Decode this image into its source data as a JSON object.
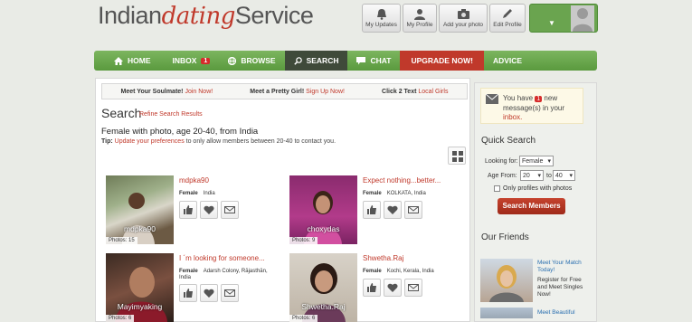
{
  "brand": {
    "logo_left": "Indian",
    "logo_mid": "dating",
    "logo_right": "Service"
  },
  "header_buttons": [
    {
      "label": "My Updates",
      "icon": "bell-icon"
    },
    {
      "label": "My Profile",
      "icon": "person-icon"
    },
    {
      "label": "Add your photo",
      "icon": "camera-icon"
    },
    {
      "label": "Edit Profile",
      "icon": "pencil-icon"
    }
  ],
  "profile_menu": {
    "arrow": "▼"
  },
  "nav": {
    "home": "HOME",
    "inbox": "INBOX",
    "inbox_badge": "1",
    "browse": "BROWSE",
    "search": "SEARCH",
    "chat": "CHAT",
    "upgrade": "UPGRADE NOW!",
    "advice": "ADVICE"
  },
  "promo": {
    "p1_label": "Meet Your Soulmate!",
    "p1_link": "Join Now!",
    "p2_label": "Meet a Pretty Girl!",
    "p2_link": "Sign Up Now!",
    "p3_label": "Click 2 Text",
    "p3_link": "Local Girls"
  },
  "search": {
    "title": "Search",
    "refine": "Refine Search Results",
    "subtitle": "Female with photo, age 20-40, from India",
    "tip_label": "Tip:",
    "tip_link": "Update your preferences",
    "tip_rest": " to only allow members between 20-40 to contact you."
  },
  "results": [
    {
      "username": "mdpka90",
      "photo_name": "mdpka90",
      "photos": "Photos: 15",
      "gender": "Female",
      "location": "India",
      "location2": ""
    },
    {
      "username": "Expect nothing...better...",
      "photo_name": "choxydas",
      "photos": "Photos: 9",
      "gender": "Female",
      "location": "KOLKATA, India",
      "location2": ""
    },
    {
      "username": "I ´m looking for someone...",
      "photo_name": "Mayimyaking",
      "photos": "Photos: 6",
      "gender": "Female",
      "location": "Adarsh Colony, Rājasthān,",
      "location2": "India"
    },
    {
      "username": "Shwetha.Raj",
      "photo_name": "Shwetha.Raj",
      "photos": "Photos: 6",
      "gender": "Female",
      "location": "Kochi, Kerala, India",
      "location2": ""
    }
  ],
  "sidebar": {
    "msg_pre": "You have ",
    "msg_badge": "1",
    "msg_mid": " new message(s) in your ",
    "msg_link": "inbox.",
    "quick_search": "Quick Search",
    "looking_for_label": "Looking for:",
    "looking_for_value": "Female",
    "age_from_label": "Age From:",
    "age_from": "20",
    "age_to_label": "to",
    "age_to": "40",
    "photos_only": "Only profiles with photos",
    "search_button": "Search Members",
    "friends_title": "Our Friends",
    "friend1_link": "Meet Your Match Today!",
    "friend1_text": "Register for Free and Meet Singles Now!",
    "friend2_link": "Meet Beautiful"
  },
  "colors": {
    "nav_green": "#6aa44f",
    "accent_red": "#c0392b",
    "active_tab": "#3f4a3a"
  }
}
